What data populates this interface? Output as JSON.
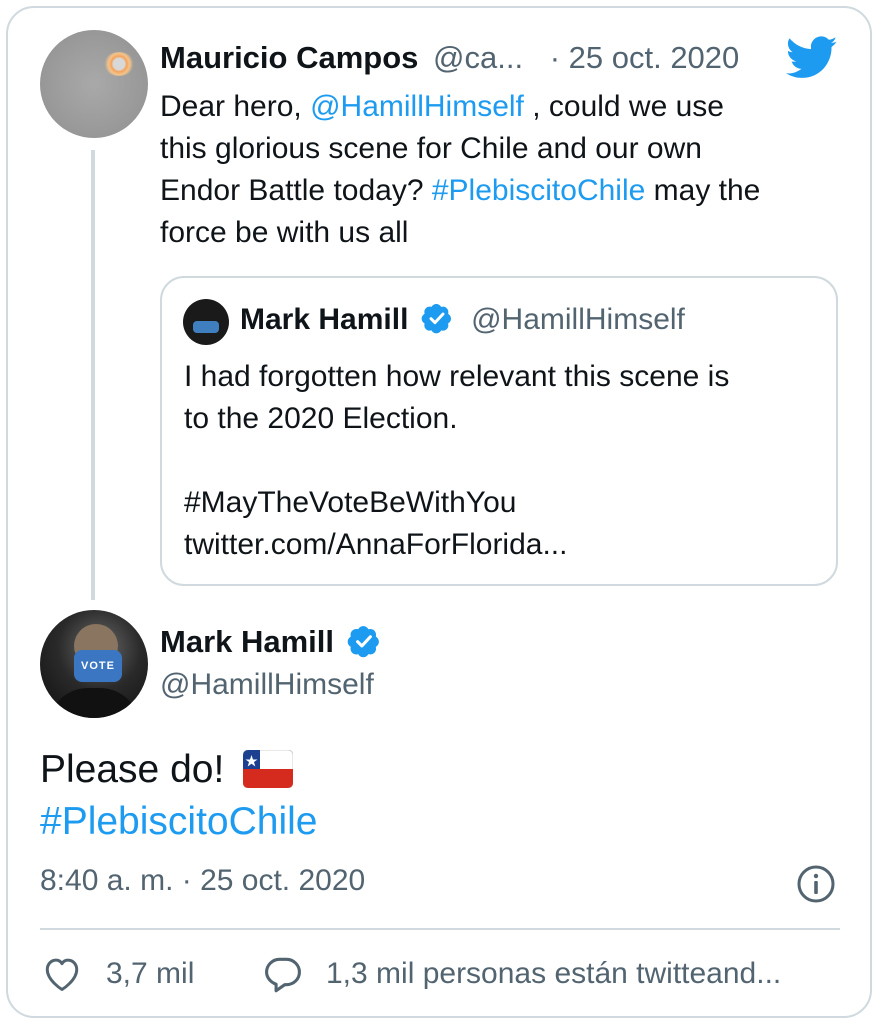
{
  "reply": {
    "author_name": "Mauricio Campos",
    "handle": "@ca...",
    "date": "· 25 oct. 2020",
    "text_part1": "Dear hero, ",
    "mention": "@HamillHimself",
    "text_part2": " , could we use",
    "line2": "this glorious scene for Chile and our own",
    "line3_start": "Endor Battle today? ",
    "hashtag": "#PlebiscitoChile",
    "line3_end": " may the",
    "line4": "force be with us all"
  },
  "quote": {
    "author_name": "Mark Hamill",
    "handle": "@HamillHimself",
    "line1": "I had forgotten how relevant this scene is",
    "line2": "to the 2020 Election.",
    "line3": "#MayTheVoteBeWithYou",
    "line4": "twitter.com/AnnaForFlorida..."
  },
  "main": {
    "author_name": "Mark Hamill",
    "handle": "@HamillHimself",
    "text": "Please do!",
    "hashtag": "#PlebiscitoChile",
    "timestamp": "8:40 a. m. · 25 oct. 2020",
    "mask_text": "VOTE"
  },
  "actions": {
    "likes": "3,7 mil",
    "talking": "1,3 mil personas están twitteand..."
  },
  "colors": {
    "accent": "#1d9bf0",
    "text": "#0f1419",
    "muted": "#536471",
    "border": "#cfd9de"
  }
}
